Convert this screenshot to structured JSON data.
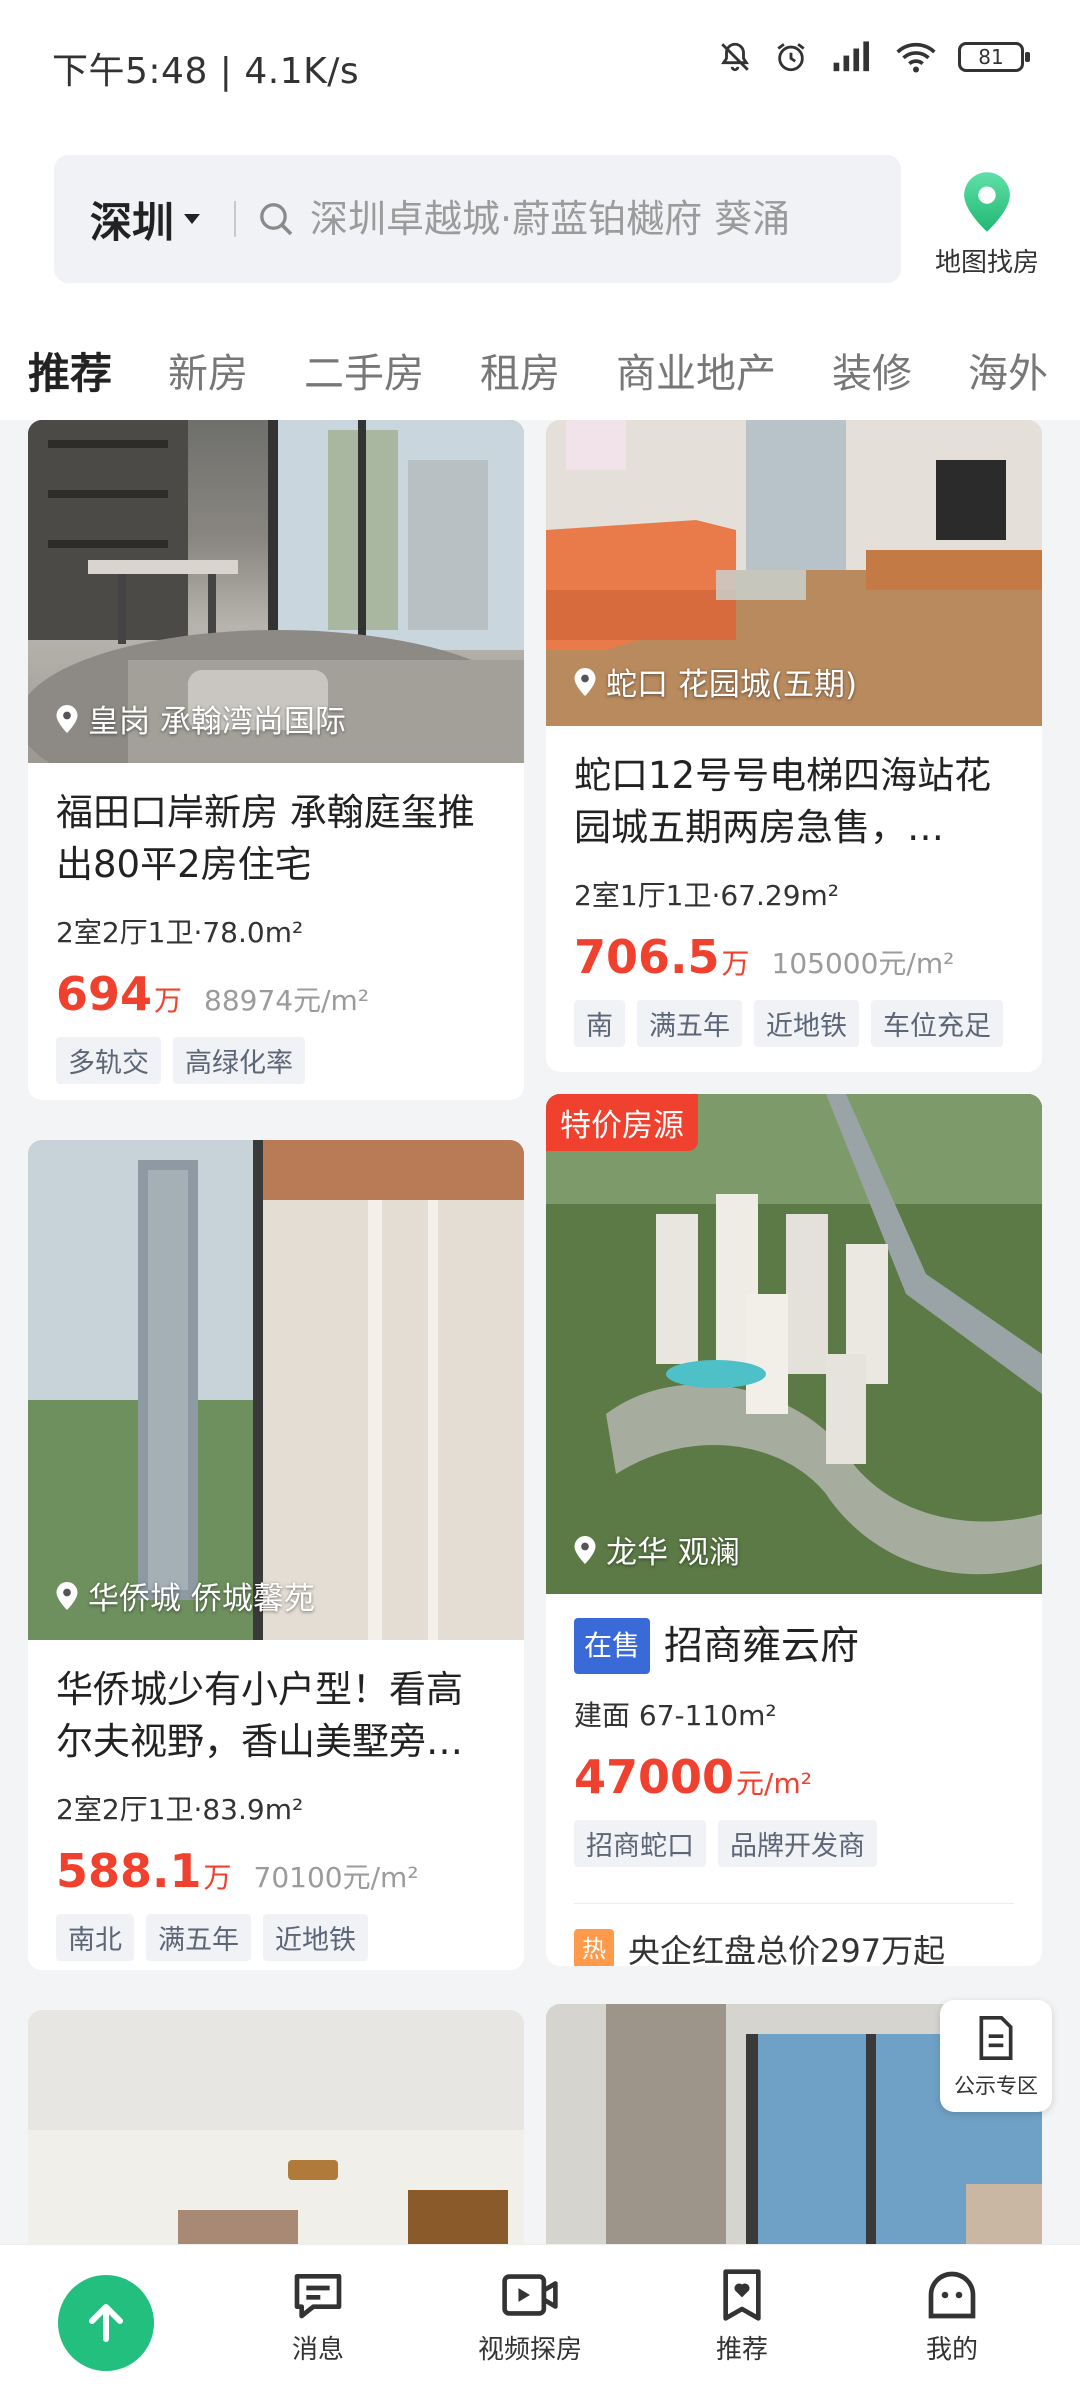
{
  "status_bar": {
    "time": "下午5:48 | 4.1K/s",
    "battery": "81"
  },
  "header": {
    "city": "深圳",
    "search_placeholder": "深圳卓越城·蔚蓝铂樾府 葵涌",
    "map_label": "地图找房"
  },
  "tabs": [
    "推荐",
    "新房",
    "二手房",
    "租房",
    "商业地产",
    "装修",
    "海外"
  ],
  "listings": [
    {
      "location": "皇岗 承翰湾尚国际",
      "title": "福田口岸新房 承翰庭玺推出80平2房住宅",
      "spec": "2室2厅1卫·78.0m²",
      "price": "694",
      "price_unit": "万",
      "unit_price": "88974元/m²",
      "tags": [
        "多轨交",
        "高绿化率"
      ]
    },
    {
      "location": "蛇口 花园城(五期)",
      "title": "蛇口12号号电梯四海站花园城五期两房急售，…",
      "spec": "2室1厅1卫·67.29m²",
      "price": "706.5",
      "price_unit": "万",
      "unit_price": "105000元/m²",
      "tags": [
        "南",
        "满五年",
        "近地铁",
        "车位充足"
      ]
    },
    {
      "location": "华侨城 侨城馨苑",
      "title": "华侨城少有小户型！看高尔夫视野，香山美墅旁…",
      "spec": "2室2厅1卫·83.9m²",
      "price": "588.1",
      "price_unit": "万",
      "unit_price": "70100元/m²",
      "tags": [
        "南北",
        "满五年",
        "近地铁"
      ]
    },
    {
      "badge": "特价房源",
      "location": "龙华 观澜",
      "status": "在售",
      "title": "招商雍云府",
      "spec": "建面 67-110m²",
      "price": "47000",
      "price_unit": "元/m²",
      "tags": [
        "招商蛇口",
        "品牌开发商"
      ],
      "hot_icon": "热",
      "hot_text": "央企红盘总价297万起"
    }
  ],
  "floating": {
    "notice_label": "公示专区"
  },
  "bottom_nav": {
    "items": [
      {
        "label": "消息",
        "icon": "message-icon"
      },
      {
        "label": "视频探房",
        "icon": "video-icon"
      },
      {
        "label": "推荐",
        "icon": "recommend-icon"
      },
      {
        "label": "我的",
        "icon": "profile-icon"
      }
    ]
  },
  "colors": {
    "accent": "#22bf7e",
    "price": "#f0402e",
    "sale_badge": "#3a69d8"
  }
}
